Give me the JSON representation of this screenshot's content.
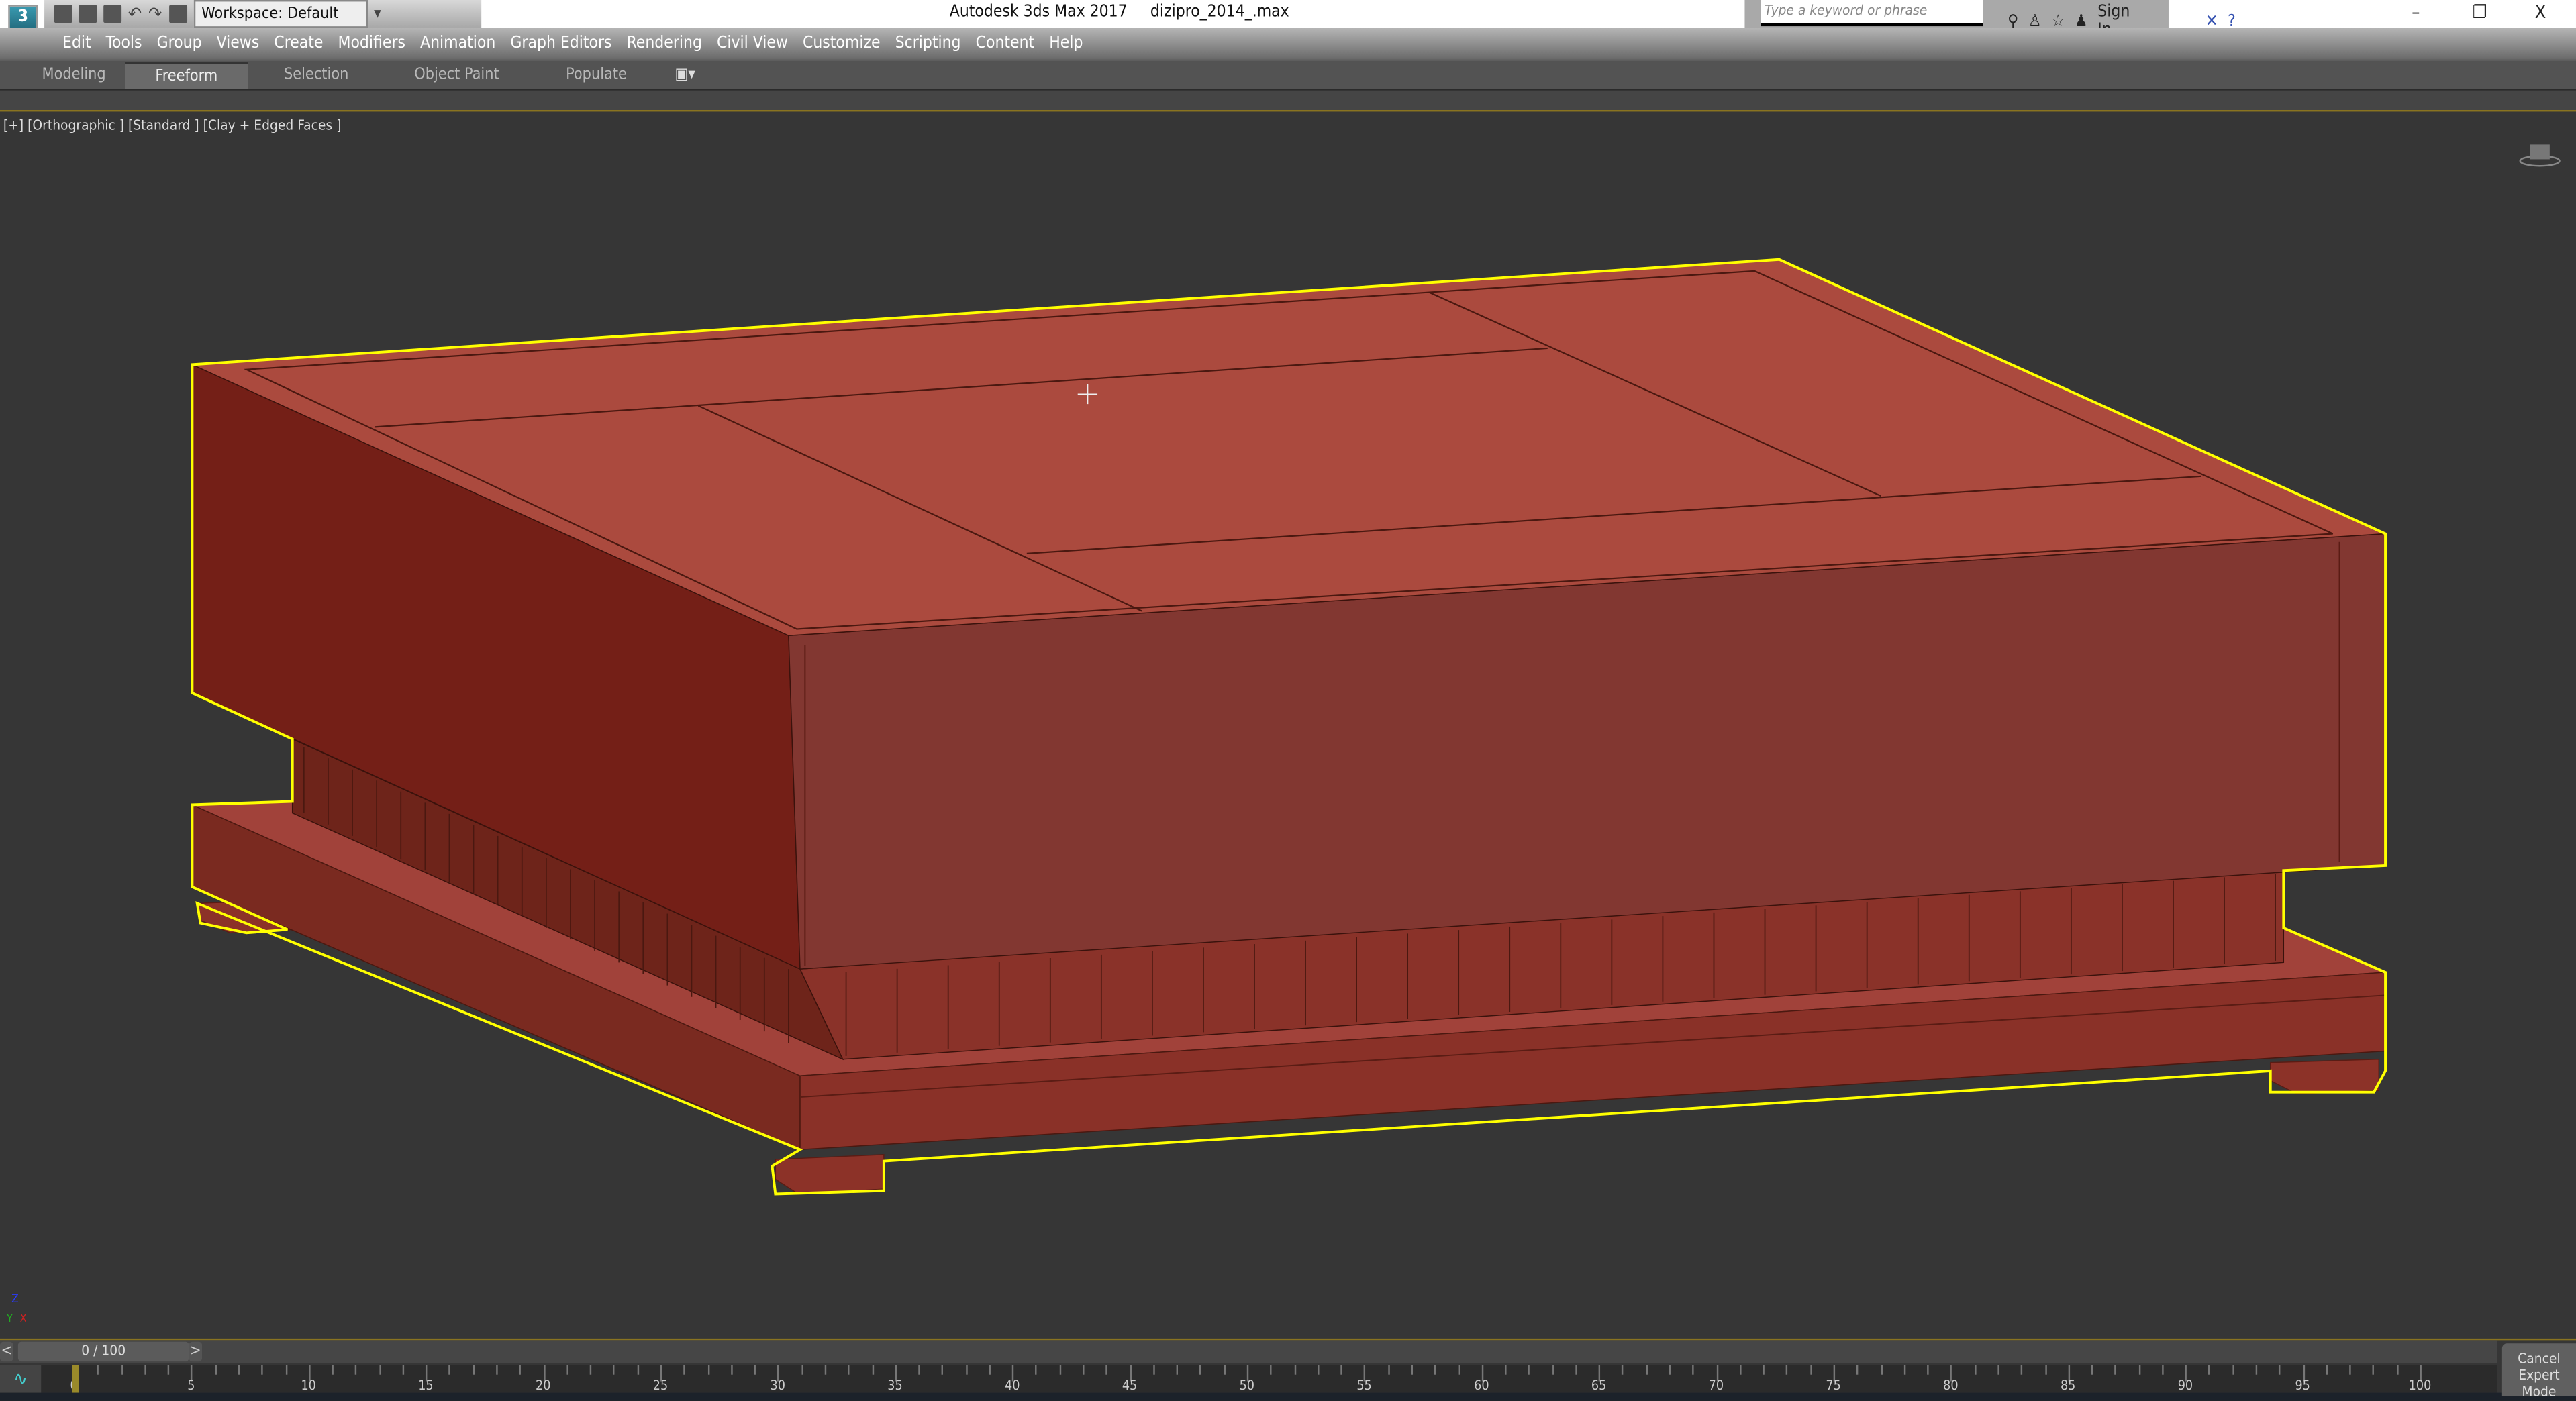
{
  "app": {
    "title": "Autodesk 3ds Max 2017",
    "file": "dizipro_2014_.max",
    "logo": "3 MAX"
  },
  "quick_access": {
    "workspace": "Workspace: Default",
    "icons": [
      "new-file-icon",
      "open-file-icon",
      "save-icon",
      "undo-icon",
      "redo-icon",
      "project-icon"
    ]
  },
  "search": {
    "placeholder": "Type a keyword or phrase",
    "sign_in": "Sign In"
  },
  "window_controls": {
    "minimize": "–",
    "restore": "❐",
    "close": "X"
  },
  "menu": [
    "Edit",
    "Tools",
    "Group",
    "Views",
    "Create",
    "Modifiers",
    "Animation",
    "Graph Editors",
    "Rendering",
    "Civil View",
    "Customize",
    "Scripting",
    "Content",
    "Help"
  ],
  "ribbon_tabs": [
    {
      "label": "Modeling",
      "active": false
    },
    {
      "label": "Freeform",
      "active": true
    },
    {
      "label": "Selection",
      "active": false
    },
    {
      "label": "Object Paint",
      "active": false
    },
    {
      "label": "Populate",
      "active": false
    }
  ],
  "viewport": {
    "label": "[+] [Orthographic ] [Standard ] [Clay + Edged Faces ]",
    "object_color": "#a9473c",
    "selection_color": "#ffff00",
    "axis": {
      "z": "Z",
      "y": "Y",
      "x": "X"
    }
  },
  "timeline": {
    "frame": "0 / 100",
    "prev": "<",
    "next": ">",
    "current_frame": 0,
    "ticks": [
      0,
      5,
      10,
      15,
      20,
      25,
      30,
      35,
      40,
      45,
      50,
      55,
      60,
      65,
      70,
      75,
      80,
      85,
      90,
      95,
      100
    ]
  },
  "expert_mode": {
    "line1": "Cancel",
    "line2": "Expert Mode"
  }
}
